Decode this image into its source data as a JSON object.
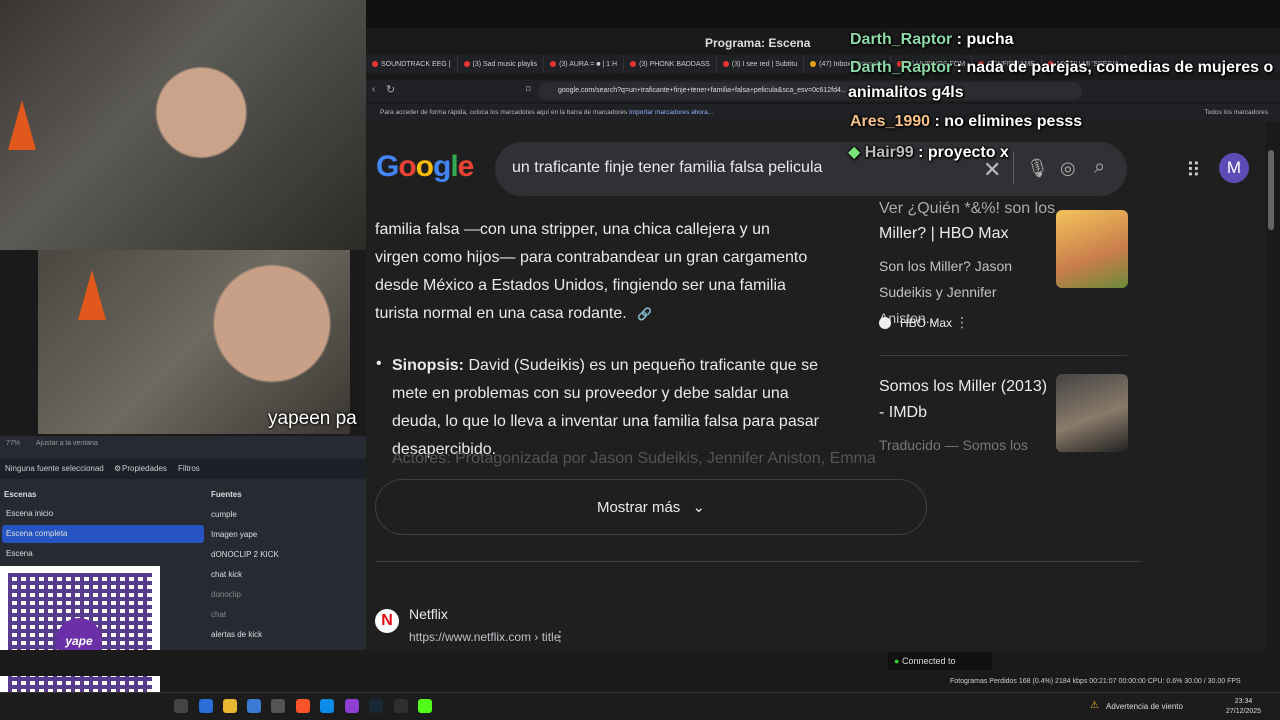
{
  "obs": {
    "preview_label": "Programa: Escena",
    "zoom": "77%",
    "fit_label": "Ajustar a la ventana",
    "no_source": "Ninguna fuente seleccionad",
    "properties": "Propiedades",
    "filters": "Filtros",
    "scenes_header": "Escenas",
    "sources_header": "Fuentes",
    "scenes": [
      "Escena inicio",
      "Escena completa",
      "Escena"
    ],
    "sources": [
      "cumple",
      "Imagen yape",
      "dONOCLIP 2 KICK",
      "chat kick",
      "donoclip",
      "chat",
      "alertas de kick"
    ],
    "connected": "Connected to",
    "stats": "Fotogramas Perdidos 168 (0.4%)   2184 kbps   00:21:07   00:00:00   CPU: 0.6%   30.00 / 30.00 FPS"
  },
  "webcam": {
    "caption": "yapeen pa"
  },
  "qr": {
    "badge": "yape"
  },
  "browser": {
    "tabs": [
      "SOUNDTRACK EEG |",
      "(3) Sad music playlis",
      "(3) AURA = ■ | 1 H",
      "(3) PHONK BADDASS",
      "(3) I see red | Subtitu",
      "(47) Inbox | Donoclip",
      "(3) HUBWOS FOM",
      "CONFIRMAME",
      "MY TIU MI 'SPECIA"
    ],
    "url": "google.com/search?q=un+traficante+finje+tener+familia+falsa+pelicula&sca_esv=0c612fd4...",
    "bookmarks_hint": "Para acceder de forma rápida, coloca los marcadores aquí en la barra de marcadores",
    "bookmarks_link": "Importar marcadores ahora...",
    "all_bookmarks": "Todos los marcadores"
  },
  "google": {
    "query": "un traficante finje tener familia falsa pelicula",
    "avatar_letter": "M",
    "paragraph": "familia falsa —con una stripper, una chica callejera y un virgen como hijos— para contrabandear un gran cargamento desde México a Estados Unidos, fingiendo ser una familia turista normal en una casa rodante.",
    "synopsis_label": "Sinopsis:",
    "synopsis_text": " David (Sudeikis) es un pequeño traficante que se mete en problemas con su proveedor y debe saldar una deuda, lo que lo lleva a inventar una familia falsa para pasar desapercibido.",
    "faded_line": "Actores: Protagonizada por Jason Sudeikis, Jennifer Aniston, Emma",
    "show_more": "Mostrar más",
    "result_site": "Netflix",
    "result_url": "https://www.netflix.com › title",
    "side_result_1_title_top": "Ver ¿Quién *&%! son los",
    "side_result_1_title": "Miller? | HBO Max",
    "side_result_1_desc": "Son los Miller? Jason Sudeikis y Jennifer Aniston...",
    "side_result_1_source": "HBO Max",
    "side_result_2_title": "Somos los Miller (2013) - IMDb",
    "side_result_2_desc": "Traducido — Somos los"
  },
  "chat": [
    {
      "user": "Darth_Raptor",
      "msg": " : pucha"
    },
    {
      "user": "Darth_Raptor",
      "msg": " : nada de parejas, comedias de mujeres o"
    },
    {
      "user": "",
      "msg": "animalitos g4ls"
    },
    {
      "user": "Ares_1990",
      "msg": " : no elimines pesss"
    },
    {
      "user": "Hair99",
      "msg": " : proyecto x"
    }
  ],
  "taskbar": {
    "weather": "Advertencia de viento",
    "time": "23:34",
    "date": "27/12/2025"
  },
  "colors": {
    "accent": "#2754c3",
    "chat_user": "#8fd9a8",
    "netflix": "#e50914"
  }
}
